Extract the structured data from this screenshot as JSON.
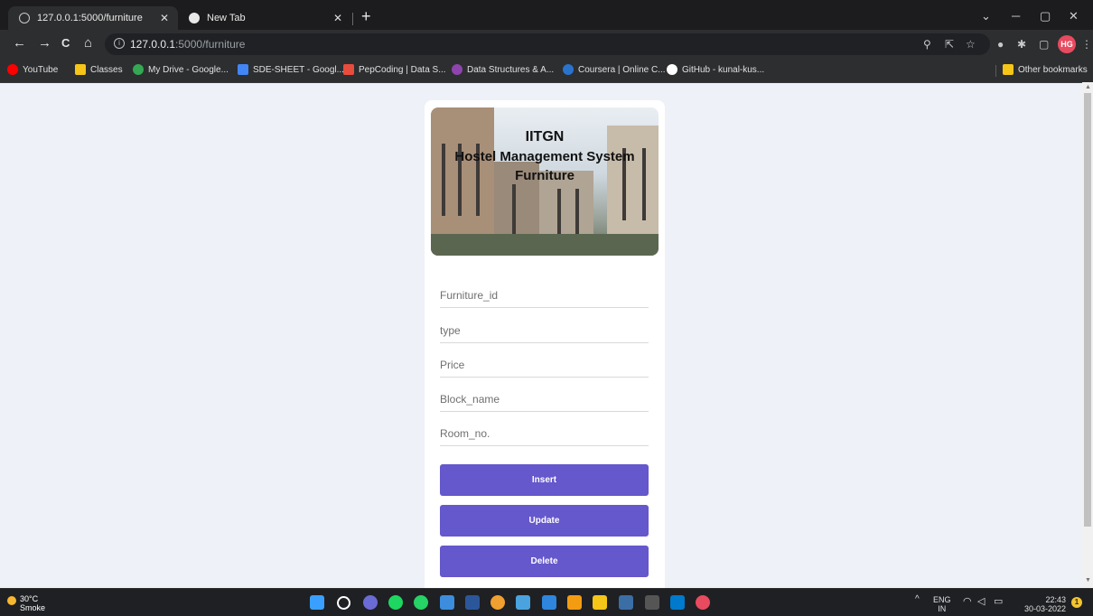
{
  "tabs": [
    {
      "title": "127.0.0.1:5000/furniture"
    },
    {
      "title": "New Tab"
    }
  ],
  "window_controls": {
    "dropdown": "⌄",
    "minimize": "─",
    "maximize": "▢",
    "close": "✕"
  },
  "toolbar": {
    "back": "←",
    "forward": "→",
    "reload": "C",
    "home": "⌂",
    "url_host": "127.0.0.1",
    "url_path": ":5000/furniture"
  },
  "bookmarks": [
    {
      "label": "YouTube",
      "color": "#ff0000"
    },
    {
      "label": "Classes",
      "color": "#f5c518"
    },
    {
      "label": "My Drive - Google...",
      "color": "#34a853"
    },
    {
      "label": "SDE-SHEET - Googl...",
      "color": "#4285f4"
    },
    {
      "label": "PepCoding | Data S...",
      "color": "#e74c3c"
    },
    {
      "label": "Data Structures & A...",
      "color": "#8e44ad"
    },
    {
      "label": "Coursera | Online C...",
      "color": "#2a73cc"
    },
    {
      "label": "GitHub - kunal-kus...",
      "color": "#ffffff"
    }
  ],
  "other_bookmarks": "Other bookmarks",
  "header": {
    "line1": "IITGN",
    "line2": "Hostel Management System",
    "line3": "Furniture"
  },
  "form": {
    "fields": [
      "Furniture_id",
      "type",
      "Price",
      "Block_name",
      "Room_no."
    ],
    "buttons": [
      "Insert",
      "Update",
      "Delete"
    ],
    "accent_color": "#6557cc"
  },
  "taskbar": {
    "temperature": "30°C",
    "condition": "Smoke",
    "lang_top": "ENG",
    "lang_bottom": "IN",
    "time": "22:43",
    "date": "30-03-2022",
    "notification_count": "1"
  }
}
